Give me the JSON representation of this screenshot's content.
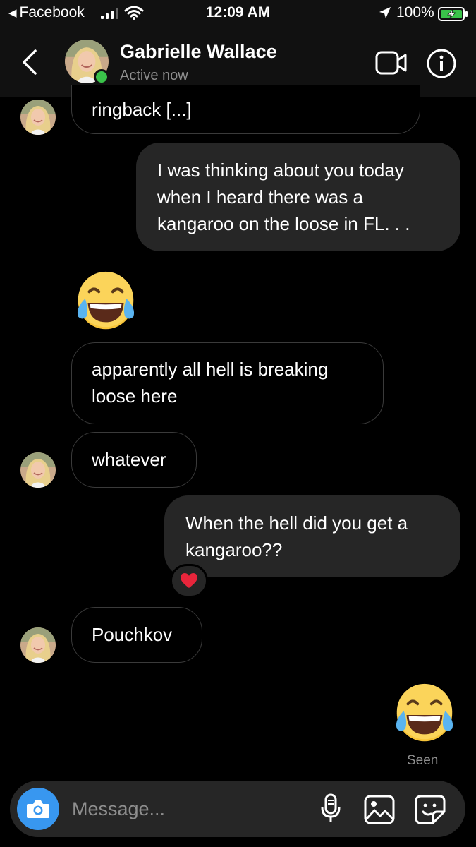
{
  "status_bar": {
    "back_app": "Facebook",
    "time": "12:09 AM",
    "battery": "100%"
  },
  "header": {
    "name": "Gabrielle Wallace",
    "status": "Active now",
    "icons": [
      "back-chevron-icon",
      "video-call-icon",
      "info-icon"
    ]
  },
  "messages": [
    {
      "side": "in",
      "text_lines": [
        "ringback [...]"
      ],
      "avatar": true
    },
    {
      "side": "out",
      "text_lines": [
        "I was thinking about you today",
        "when I heard there was a",
        "kangaroo on the loose in FL. . ."
      ]
    },
    {
      "side": "in",
      "emoji": "face-with-tears-of-joy"
    },
    {
      "side": "in",
      "text_lines": [
        "apparently all hell is breaking",
        "loose here"
      ]
    },
    {
      "side": "in",
      "text_lines": [
        "whatever"
      ],
      "avatar": true
    },
    {
      "side": "out",
      "text_lines": [
        "When the hell did you get a",
        "kangaroo??"
      ],
      "reaction": "red-heart"
    },
    {
      "side": "in",
      "text_lines": [
        "Pouchkov"
      ],
      "avatar": true
    },
    {
      "side": "out",
      "emoji": "face-with-tears-of-joy"
    }
  ],
  "seen_label": "Seen",
  "composer": {
    "placeholder": "Message...",
    "icons": [
      "camera-icon",
      "microphone-icon",
      "gallery-icon",
      "sticker-icon"
    ]
  },
  "colors": {
    "background": "#000000",
    "bar": "#111111",
    "outgoing_bubble": "#262626",
    "incoming_border": "#3a3a3a",
    "online": "#3ac34a",
    "camera": "#3897f0",
    "muted_text": "#8e8e8e"
  }
}
